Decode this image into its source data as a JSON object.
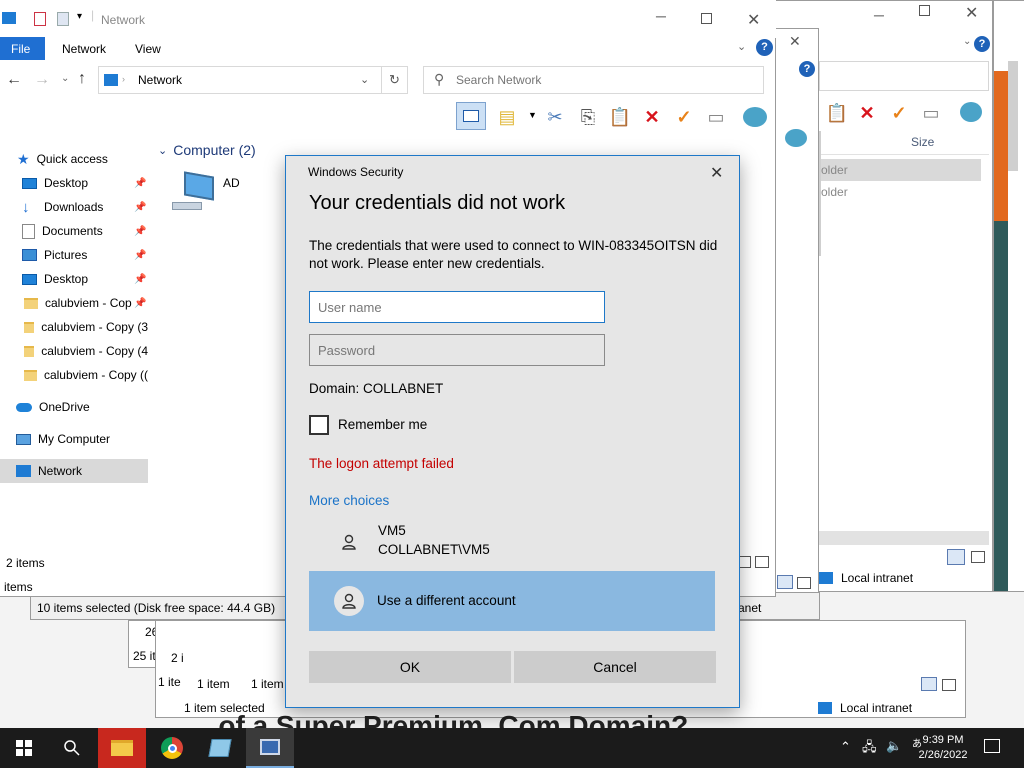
{
  "explorer": {
    "title": "Network",
    "ribbon_tabs": [
      "File",
      "Network",
      "View"
    ],
    "address": "Network",
    "search_placeholder": "Search Network",
    "group_header": "Computer (2)",
    "items": [
      {
        "label": "AD"
      }
    ],
    "status": "2 items",
    "nav": {
      "quick_access": "Quick access",
      "pinned": [
        "Desktop",
        "Downloads",
        "Documents",
        "Pictures",
        "Desktop"
      ],
      "folders": [
        "calubviem - Cop",
        "calubviem - Copy (3",
        "calubviem - Copy (4",
        "calubviem - Copy (("
      ],
      "onedrive": "OneDrive",
      "my_computer": "My Computer",
      "network": "Network"
    }
  },
  "background": {
    "size_header": "Size",
    "folder_rows": [
      "older",
      "older"
    ],
    "zone_label": "Local intranet",
    "items_label": "items",
    "status_selected": "10 items selected (Disk free space: 44.4 GB)",
    "frag_26": "26",
    "frag_25": "25 ite",
    "frag_2i": "2 i",
    "frag_1it": "1 ite",
    "one_item": "1 item",
    "one_item_b": "1 item",
    "one_item_selected": "1 item selected",
    "zone_label_b": "Local intranet",
    "frag_anet": "anet",
    "headline_fragment": "...of a Super Premium .Com Domain?"
  },
  "dialog": {
    "window_title": "Windows Security",
    "heading": "Your credentials did not work",
    "message": "The credentials that were used to connect to WIN-083345OITSN did not work. Please enter new credentials.",
    "username_placeholder": "User name",
    "password_placeholder": "Password",
    "domain": "Domain: COLLABNET",
    "remember": "Remember me",
    "error": "The logon attempt failed",
    "more_choices": "More choices",
    "account_name": "VM5",
    "account_id": "COLLABNET\\VM5",
    "other_account": "Use a different account",
    "ok": "OK",
    "cancel": "Cancel"
  },
  "taskbar": {
    "time": "9:39 PM",
    "date": "2/26/2022"
  },
  "colors": {
    "accent": "#1a73c8",
    "error": "#c40000",
    "selected_account": "#8ab8e0",
    "taskbar": "#1b1b1b"
  }
}
